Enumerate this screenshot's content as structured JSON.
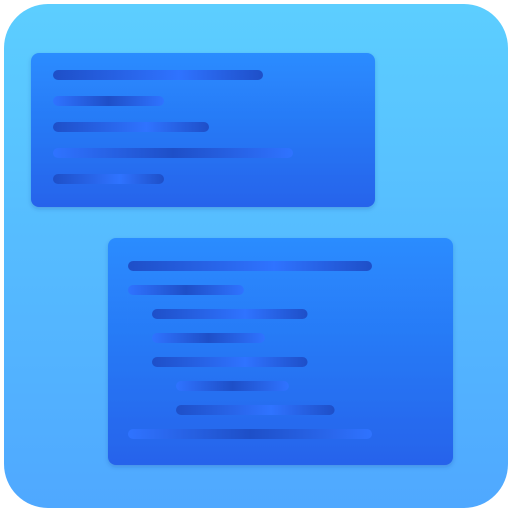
{
  "icon": {
    "name": "code-snippets-app-icon",
    "colors": {
      "tile_top": "#5CCEFF",
      "tile_bottom": "#4FA8FF",
      "panel_top": "#2A8CFF",
      "panel_bottom": "#2563EB",
      "line_dark": "#1E4FC8",
      "line_bright": "#2F73FF"
    }
  },
  "panels": [
    {
      "name": "top-code-panel",
      "lines": [
        {
          "indent": 0,
          "length": 0.7
        },
        {
          "indent": 0,
          "length": 0.37
        },
        {
          "indent": 0,
          "length": 0.52
        },
        {
          "indent": 0,
          "length": 0.8
        },
        {
          "indent": 0,
          "length": 0.37
        }
      ]
    },
    {
      "name": "bottom-code-panel",
      "lines": [
        {
          "indent": 0,
          "length": 0.8
        },
        {
          "indent": 0,
          "length": 0.38
        },
        {
          "indent": 1,
          "length": 0.51
        },
        {
          "indent": 1,
          "length": 0.37
        },
        {
          "indent": 1,
          "length": 0.51
        },
        {
          "indent": 2,
          "length": 0.37
        },
        {
          "indent": 2,
          "length": 0.52
        },
        {
          "indent": 0,
          "length": 0.8
        }
      ]
    }
  ]
}
